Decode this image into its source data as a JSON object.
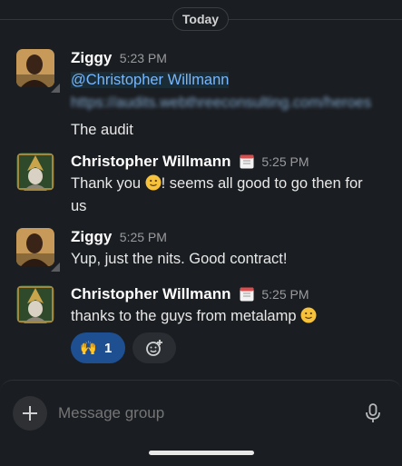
{
  "divider": {
    "label": "Today"
  },
  "messages": [
    {
      "author": "Ziggy",
      "time": "5:23 PM",
      "mention": "@Christopher Willmann",
      "link": "https://audits.webthreeconsulting.com/heroes",
      "text": "The audit"
    },
    {
      "author": "Christopher Willmann",
      "time": "5:25 PM",
      "text_a": "Thank you ",
      "text_b": "! seems all good to go then for",
      "text_c": "us"
    },
    {
      "author": "Ziggy",
      "time": "5:25 PM",
      "text": "Yup, just the nits. Good contract!"
    },
    {
      "author": "Christopher Willmann",
      "time": "5:25 PM",
      "text": "thanks to the guys from metalamp "
    }
  ],
  "reactions": [
    {
      "emoji": "🙌",
      "count": "1",
      "icon": "raised-hands"
    },
    {
      "icon": "add-reaction-icon"
    }
  ],
  "composer": {
    "placeholder": "Message group"
  },
  "colors": {
    "background": "#1a1d21",
    "accent": "#1d4f91",
    "mention": "#77b7ff"
  }
}
